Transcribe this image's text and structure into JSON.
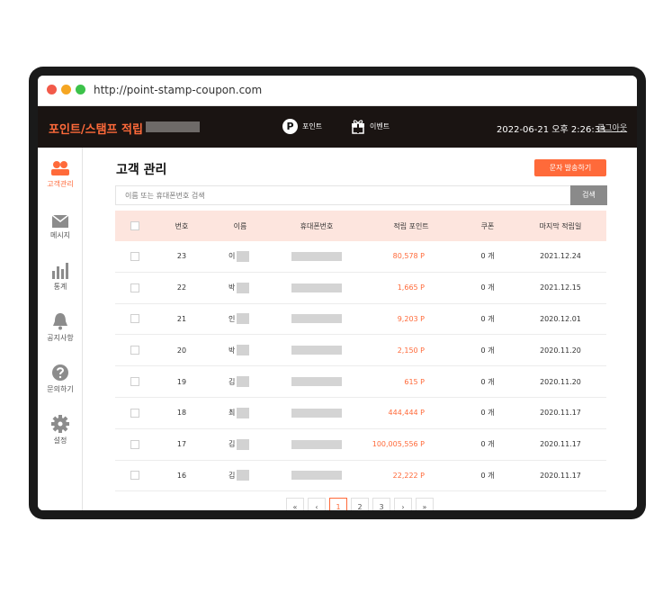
{
  "browser": {
    "url": "http://point-stamp-coupon.com"
  },
  "header": {
    "brand": "포인트/스탬프 적립",
    "nav_point": "포인트",
    "nav_point_icon": "P",
    "nav_event": "이벤트",
    "datetime": "2022-06-21 오후 2:26:33",
    "logout": "로그아웃"
  },
  "sidebar": {
    "items": [
      {
        "label": "고객관리",
        "icon": "users-icon",
        "active": true
      },
      {
        "label": "메시지",
        "icon": "mail-icon"
      },
      {
        "label": "통계",
        "icon": "bar-chart-icon"
      },
      {
        "label": "공지사항",
        "icon": "bell-icon"
      },
      {
        "label": "문의하기",
        "icon": "question-icon"
      },
      {
        "label": "설정",
        "icon": "gear-icon"
      }
    ]
  },
  "main": {
    "title": "고객 관리",
    "sms_button": "문자 발송하기",
    "search_placeholder": "이름 또는 휴대폰번호 검색",
    "search_button": "검색",
    "columns": [
      "번호",
      "이름",
      "휴대폰번호",
      "적립 포인트",
      "쿠폰",
      "마지막 적립일"
    ],
    "rows": [
      {
        "no": "23",
        "name": "이",
        "points": "80,578 P",
        "coupon": "0 개",
        "date": "2021.12.24"
      },
      {
        "no": "22",
        "name": "박",
        "points": "1,665 P",
        "coupon": "0 개",
        "date": "2021.12.15"
      },
      {
        "no": "21",
        "name": "인",
        "points": "9,203 P",
        "coupon": "0 개",
        "date": "2020.12.01"
      },
      {
        "no": "20",
        "name": "박",
        "points": "2,150 P",
        "coupon": "0 개",
        "date": "2020.11.20"
      },
      {
        "no": "19",
        "name": "김",
        "points": "615 P",
        "coupon": "0 개",
        "date": "2020.11.20"
      },
      {
        "no": "18",
        "name": "최",
        "points": "444,444 P",
        "coupon": "0 개",
        "date": "2020.11.17"
      },
      {
        "no": "17",
        "name": "김",
        "points": "100,005,556 P",
        "coupon": "0 개",
        "date": "2020.11.17"
      },
      {
        "no": "16",
        "name": "김",
        "points": "22,222 P",
        "coupon": "0 개",
        "date": "2020.11.17"
      }
    ]
  },
  "pagination": {
    "first": "«",
    "prev": "‹",
    "pages": [
      "1",
      "2",
      "3"
    ],
    "current": "1",
    "next": "›",
    "last": "»"
  },
  "colors": {
    "accent": "#ff6a3a",
    "header_bg": "#1a1412",
    "table_head_bg": "#fde5de"
  }
}
